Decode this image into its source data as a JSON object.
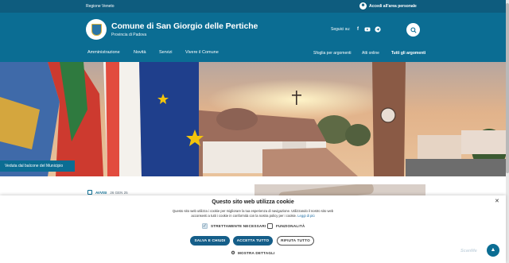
{
  "topbar": {
    "region": "Regione Veneto",
    "login": "Accedi all'area personale"
  },
  "header": {
    "title": "Comune di San Giorgio delle Pertiche",
    "subtitle": "Provincia di Padova",
    "social_label": "Seguici su:",
    "social": [
      "facebook-icon",
      "youtube-icon",
      "telegram-icon"
    ]
  },
  "nav": {
    "main": [
      "Amministrazione",
      "Novità",
      "Servizi",
      "Vivere il Comune"
    ],
    "secondary": [
      "Sfoglia per argomenti",
      "Atti online",
      "Tutti gli argomenti"
    ]
  },
  "hero": {
    "caption": "Veduta dal balcone del Municipio"
  },
  "content": {
    "tag": "AVVISI",
    "date": "26 GEN 25"
  },
  "cookie": {
    "title": "Questo sito web utilizza cookie",
    "text": "Questo sito web utilizza i cookie per migliorare la tua esperienza di navigazione. Utilizzando il nostro sito web acconsenti a tutti i cookie in conformità con la nostra policy per i cookie.",
    "link": "Leggi di più",
    "checkboxes": [
      {
        "label": "STRETTAMENTE NECESSARI",
        "checked": true
      },
      {
        "label": "FUNZIONALITÀ",
        "checked": false
      }
    ],
    "buttons": {
      "save": "SALVA E CHIUDI",
      "accept": "ACCETTA TUTTO",
      "reject": "RIFIUTA TUTTO"
    },
    "details": "MOSTRA DETTAGLI",
    "brand": "ScanMe"
  },
  "colors": {
    "primary": "#0b6d93",
    "topbar": "#0e5c7e",
    "button": "#155e89"
  }
}
